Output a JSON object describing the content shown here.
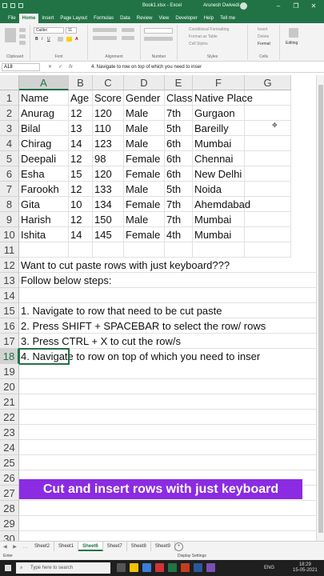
{
  "titlebar": {
    "title": "Book1.xlsx - Excel",
    "user": "Arunesh Dwivedi"
  },
  "ribbon_tabs": [
    "File",
    "Home",
    "Insert",
    "Page Layout",
    "Formulas",
    "Data",
    "Review",
    "View",
    "Developer",
    "Help",
    "Tell me"
  ],
  "ribbon": {
    "font_name": "Calibri",
    "font_size": "11",
    "cond_format": "Conditional Formatting",
    "format_table": "Format as Table",
    "cell_styles": "Cell Styles",
    "insert": "Insert",
    "delete": "Delete",
    "format": "Format",
    "editing": "Editing",
    "groups": [
      "Clipboard",
      "Font",
      "Alignment",
      "Number",
      "Styles",
      "Cells"
    ]
  },
  "formula_bar": {
    "name_box": "A18",
    "cancel": "✕",
    "enter": "✓",
    "fx": "fx",
    "formula": "4. Navigate to row on top of which you need to inser"
  },
  "columns": [
    "A",
    "B",
    "C",
    "D",
    "E",
    "F",
    "G"
  ],
  "selected_column": "A",
  "rows": [
    {
      "n": "1",
      "cells": [
        "Name",
        "Age",
        "Score",
        "Gender",
        "Class",
        "Native Place",
        ""
      ]
    },
    {
      "n": "2",
      "cells": [
        "Anurag",
        "12",
        "120",
        "Male",
        "7th",
        "Gurgaon",
        ""
      ]
    },
    {
      "n": "3",
      "cells": [
        "Bilal",
        "13",
        "110",
        "Male",
        "5th",
        "Bareilly",
        ""
      ]
    },
    {
      "n": "4",
      "cells": [
        "Chirag",
        "14",
        "123",
        "Male",
        "6th",
        "Mumbai",
        ""
      ]
    },
    {
      "n": "5",
      "cells": [
        "Deepali",
        "12",
        "98",
        "Female",
        "6th",
        "Chennai",
        ""
      ]
    },
    {
      "n": "6",
      "cells": [
        "Esha",
        "15",
        "120",
        "Female",
        "6th",
        "New Delhi",
        ""
      ]
    },
    {
      "n": "7",
      "cells": [
        "Farookh",
        "12",
        "133",
        "Male",
        "5th",
        "Noida",
        ""
      ]
    },
    {
      "n": "8",
      "cells": [
        "Gita",
        "10",
        "134",
        "Female",
        "7th",
        "Ahemdabad",
        ""
      ]
    },
    {
      "n": "9",
      "cells": [
        "Harish",
        "12",
        "150",
        "Male",
        "7th",
        "Mumbai",
        ""
      ]
    },
    {
      "n": "10",
      "cells": [
        "Ishita",
        "14",
        "145",
        "Female",
        "4th",
        "Mumbai",
        ""
      ]
    },
    {
      "n": "11",
      "cells": [
        "",
        "",
        "",
        "",
        "",
        "",
        ""
      ]
    },
    {
      "n": "12",
      "text": "Want to cut paste rows with just keyboard???"
    },
    {
      "n": "13",
      "text": "Follow below steps:"
    },
    {
      "n": "14",
      "text": ""
    },
    {
      "n": "15",
      "text": "1. Navigate to row that need to be cut paste"
    },
    {
      "n": "16",
      "text": "2. Press SHIFT + SPACEBAR to select the row/ rows"
    },
    {
      "n": "17",
      "text": "3. Press CTRL + X to cut the row/s"
    },
    {
      "n": "18",
      "text": "4. Navigate to row on top of which you need to inser"
    },
    {
      "n": "19",
      "text": ""
    },
    {
      "n": "20",
      "text": ""
    },
    {
      "n": "21",
      "text": ""
    },
    {
      "n": "22",
      "text": ""
    },
    {
      "n": "23",
      "text": ""
    },
    {
      "n": "24",
      "text": ""
    },
    {
      "n": "25",
      "text": ""
    },
    {
      "n": "26",
      "text": ""
    },
    {
      "n": "27",
      "text": ""
    },
    {
      "n": "28",
      "text": ""
    },
    {
      "n": "29",
      "text": ""
    },
    {
      "n": "30",
      "text": ""
    }
  ],
  "selected_row": "18",
  "banner": "Cut and insert rows with just keyboard",
  "sheet_tabs": [
    "Sheet2",
    "Sheet1",
    "Sheet6",
    "Sheet7",
    "Sheet8",
    "Sheet9"
  ],
  "active_sheet": "Sheet6",
  "status": {
    "mode": "Enter",
    "display_settings": "Display Settings"
  },
  "taskbar": {
    "search_placeholder": "Type here to search",
    "lang": "ENG",
    "time": "18:29",
    "date": "15-05-2021"
  }
}
